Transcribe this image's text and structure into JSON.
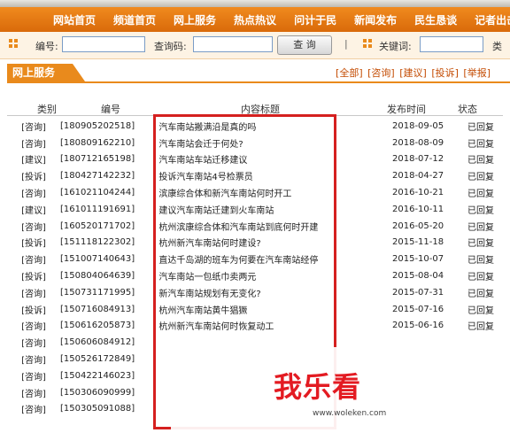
{
  "nav": [
    "网站首页",
    "频道首页",
    "网上服务",
    "热点热议",
    "问计于民",
    "新闻发布",
    "民生恳谈",
    "记者出击"
  ],
  "search": {
    "number_label": "编号:",
    "query_label": "查询码:",
    "button": "查 询",
    "separator": "|",
    "keyword_label": "关键词:",
    "category_label": "类"
  },
  "section": {
    "tab": "网上服务",
    "filters": [
      "[全部]",
      "[咨询]",
      "[建议]",
      "[投诉]",
      "[举报]"
    ]
  },
  "headers": {
    "category": "类别",
    "number": "编号",
    "title": "内容标题",
    "date": "发布时间",
    "status": "状态"
  },
  "rows": [
    {
      "category": "[咨询]",
      "number": "[180905202518]",
      "title": "汽车南站搬满沿是真的吗",
      "date": "2018-09-05",
      "status": "已回复"
    },
    {
      "category": "[咨询]",
      "number": "[180809162210]",
      "title": "汽车南站会迁于何处?",
      "date": "2018-08-09",
      "status": "已回复"
    },
    {
      "category": "[建议]",
      "number": "[180712165198]",
      "title": "汽车南站车站迁移建议",
      "date": "2018-07-12",
      "status": "已回复"
    },
    {
      "category": "[投诉]",
      "number": "[180427142232]",
      "title": "投诉汽车南站4号检票员",
      "date": "2018-04-27",
      "status": "已回复"
    },
    {
      "category": "[咨询]",
      "number": "[161021104244]",
      "title": "滨康综合体和新汽车南站何时开工",
      "date": "2016-10-21",
      "status": "已回复"
    },
    {
      "category": "[建议]",
      "number": "[161011191691]",
      "title": "建议汽车南站迁建到火车南站",
      "date": "2016-10-11",
      "status": "已回复"
    },
    {
      "category": "[咨询]",
      "number": "[160520171702]",
      "title": "杭州滨康综合体和汽车南站到底何时开建",
      "date": "2016-05-20",
      "status": "已回复"
    },
    {
      "category": "[投诉]",
      "number": "[151118122302]",
      "title": "杭州新汽车南站何时建设?",
      "date": "2015-11-18",
      "status": "已回复"
    },
    {
      "category": "[咨询]",
      "number": "[151007140643]",
      "title": "直达千岛湖的班车为何要在汽车南站经停",
      "date": "2015-10-07",
      "status": "已回复"
    },
    {
      "category": "[投诉]",
      "number": "[150804064639]",
      "title": "汽车南站一包纸巾卖两元",
      "date": "2015-08-04",
      "status": "已回复"
    },
    {
      "category": "[咨询]",
      "number": "[150731171995]",
      "title": "新汽车南站规划有无变化?",
      "date": "2015-07-31",
      "status": "已回复"
    },
    {
      "category": "[投诉]",
      "number": "[150716084913]",
      "title": "杭州汽车南站黄牛猖獗",
      "date": "2015-07-16",
      "status": "已回复"
    },
    {
      "category": "[咨询]",
      "number": "[150616205873]",
      "title": "杭州新汽车南站何时恢复动工",
      "date": "2015-06-16",
      "status": "已回复"
    },
    {
      "category": "[咨询]",
      "number": "[150606084912]",
      "title": "",
      "date": "",
      "status": ""
    },
    {
      "category": "[咨询]",
      "number": "[150526172849]",
      "title": "",
      "date": "",
      "status": ""
    },
    {
      "category": "[咨询]",
      "number": "[150422146023]",
      "title": "",
      "date": "",
      "status": ""
    },
    {
      "category": "[咨询]",
      "number": "[150306090999]",
      "title": "",
      "date": "",
      "status": ""
    },
    {
      "category": "[咨询]",
      "number": "[150305091088]",
      "title": "",
      "date": "",
      "status": ""
    }
  ],
  "watermark": {
    "text": "我乐看",
    "url": "www.woleken.com"
  },
  "colors": {
    "accent": "#e98a1c",
    "highlight_box": "#d5201f"
  }
}
